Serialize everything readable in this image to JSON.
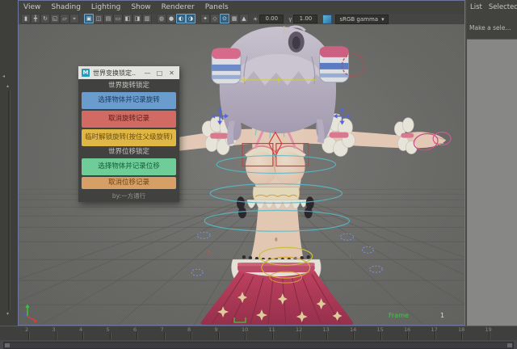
{
  "panel_menu": {
    "items": [
      "View",
      "Shading",
      "Lighting",
      "Show",
      "Renderer",
      "Panels"
    ]
  },
  "toolbar": {
    "icons": [
      {
        "name": "icon-select-tool",
        "glyph": "▮",
        "hl": false
      },
      {
        "name": "icon-move-tool",
        "glyph": "╋",
        "hl": false
      },
      {
        "name": "icon-rotate-view",
        "glyph": "↻",
        "hl": false
      },
      {
        "name": "icon-frame-region",
        "glyph": "◱",
        "hl": false
      },
      {
        "name": "icon-image-plane",
        "glyph": "▱",
        "hl": false
      },
      {
        "name": "icon-2d-pan-zoom",
        "glyph": "⌖",
        "hl": false
      },
      {
        "name": "icon-grease-pencil",
        "glyph": "▣",
        "hl": true,
        "sep": true
      },
      {
        "name": "icon-wireframe",
        "glyph": "◫",
        "hl": false
      },
      {
        "name": "icon-smooth-shade",
        "glyph": "▤",
        "hl": false
      },
      {
        "name": "icon-textured",
        "glyph": "▭",
        "hl": false
      },
      {
        "name": "icon-use-all-lights",
        "glyph": "◧",
        "hl": false
      },
      {
        "name": "icon-shadows",
        "glyph": "◨",
        "hl": false
      },
      {
        "name": "icon-ambient-occlusion",
        "glyph": "▥",
        "hl": false
      },
      {
        "name": "icon-motion-blur",
        "glyph": "◍",
        "hl": false,
        "sep": true
      },
      {
        "name": "icon-multisample-aa",
        "glyph": "●",
        "hl": false
      },
      {
        "name": "icon-depth-of-field",
        "glyph": "◐",
        "hl": true
      },
      {
        "name": "icon-isolate-select",
        "glyph": "◑",
        "hl": true
      },
      {
        "name": "icon-xray",
        "glyph": "✦",
        "hl": false,
        "sep": true
      },
      {
        "name": "icon-xray-active",
        "glyph": "◇",
        "hl": false
      },
      {
        "name": "icon-wireframe-on-shaded",
        "glyph": "⊙",
        "hl": true
      },
      {
        "name": "icon-plugin-shapes",
        "glyph": "▦",
        "hl": false
      },
      {
        "name": "icon-resolution-gate",
        "glyph": "▲",
        "hl": false
      }
    ],
    "exposure_icon": "☀",
    "exposure_value": "0.00",
    "gamma_icon": "γ",
    "gamma_value": "1.00",
    "view_transform": "sRGB gamma",
    "dropdown_arrow": "▾"
  },
  "attribute_panel": {
    "menus": [
      "List",
      "Selected"
    ],
    "hint": "Make a sele..."
  },
  "dialog": {
    "logo_letter": "M",
    "title": "世界变换锁定..",
    "controls": {
      "minimize": "—",
      "maximize": "□",
      "close": "✕"
    },
    "sections": [
      {
        "header": "世界旋转锁定",
        "buttons": [
          {
            "label": "选择物体并记录旋转",
            "color": "#6ba3dc",
            "text_color": "#123a62"
          },
          {
            "label": "取消旋转记录",
            "color": "#dd6b66",
            "text_color": "#5c1512"
          },
          {
            "label": "临时解锁旋转(按住父级旋转)",
            "color": "#eebf45",
            "text_color": "#6b4f0a"
          }
        ]
      },
      {
        "header": "世界位移锁定",
        "buttons": [
          {
            "label": "选择物体并记录位移",
            "color": "#6fd9a0",
            "text_color": "#0f5c38"
          },
          {
            "label": "取消位移记录",
            "color": "#e2a668",
            "text_color": "#6b3f10"
          }
        ]
      }
    ],
    "credit": "by:一方通行"
  },
  "viewport_hud": {
    "frame_label": "Frame",
    "frame_value": "1"
  },
  "timeline": {
    "ticks": [
      "2",
      "3",
      "4",
      "5",
      "6",
      "7",
      "8",
      "9",
      "10",
      "11",
      "12",
      "13",
      "14",
      "15",
      "16",
      "17",
      "18",
      "19"
    ]
  },
  "colors": {
    "panel_bar": "#3e3e3e",
    "viewport_bg": "#6b6b6b",
    "grid_line": "#555555",
    "active_panel_border": "#6f77a8",
    "selection_circle": "#cf4444",
    "control_cyan": "#55c6d6",
    "control_yellow": "#d6ca3e",
    "control_red": "#e23838",
    "control_magenta": "#d84a8e",
    "gizmo_blue": "#5566e8",
    "axis_x": "#d04040",
    "axis_y": "#3acb3a",
    "axis_z": "#4060d0"
  }
}
